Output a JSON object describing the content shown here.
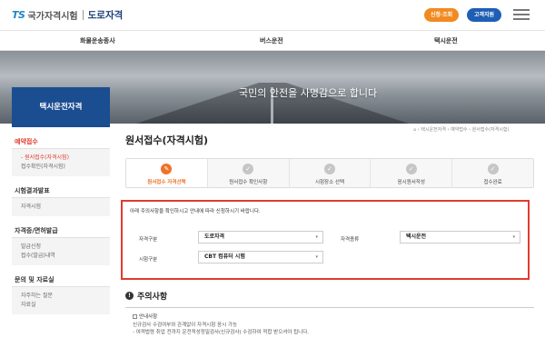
{
  "header": {
    "logo_mark": "TS",
    "logo_name": "국가자격시험",
    "logo_sub": "도로자격",
    "btn_apply_check": "신청·조회",
    "btn_support": "고객지원"
  },
  "gnb": [
    "화물운송종사",
    "버스운전",
    "택시운전"
  ],
  "banner": {
    "slogan": "국민의 안전을 사명감으로 합니다"
  },
  "sidebar": {
    "title": "택시운전자격",
    "groups": [
      {
        "label": "예약접수",
        "active": true,
        "items": [
          {
            "label": "- 원서접수(자격시험)",
            "on": true
          },
          {
            "label": "접수확인(자격시험)",
            "on": false
          }
        ]
      },
      {
        "label": "시험결과발표",
        "active": false,
        "items": [
          {
            "label": "자격시험",
            "on": false
          }
        ]
      },
      {
        "label": "자격증/면허발급",
        "active": false,
        "items": [
          {
            "label": "발급신청",
            "on": false
          },
          {
            "label": "접수(발급)내역",
            "on": false
          }
        ]
      },
      {
        "label": "문의 및 자료실",
        "active": false,
        "items": [
          {
            "label": "자주하는 질문",
            "on": false
          },
          {
            "label": "자료실",
            "on": false
          }
        ]
      }
    ]
  },
  "breadcrumb": "⌂ › 택시운전자격 › 예약접수 › 원서접수(자격시험)",
  "page": {
    "title": "원서접수(자격시험)"
  },
  "steps": [
    {
      "label": "원서접수 자격선택",
      "icon": "✎"
    },
    {
      "label": "원서접수 확인사항",
      "icon": "✓"
    },
    {
      "label": "시험장소 선택",
      "icon": "✓"
    },
    {
      "label": "응시원서작성",
      "icon": "✓"
    },
    {
      "label": "접수완료",
      "icon": "✓"
    }
  ],
  "form": {
    "notice": "아래 주의사항을 확인하시고 안내에 따라 신청하시기 바랍니다.",
    "field1_label": "자격구분",
    "field1_value": "도로자격",
    "field2_label": "자격종류",
    "field2_value": "택시운전",
    "field3_label": "시험구분",
    "field3_value": "CBT 컴퓨터 시험"
  },
  "caution": {
    "title": "주의사항",
    "check_label": "안내사항",
    "line1": "신규검사 수검여부와 관계없이 자격시험 응시 가능",
    "line2": "- 여객법령 취업 전까지 운전적성정밀검사(신규검사) 수검하여 적합 받으셔야 됩니다."
  },
  "colors": {
    "accent_orange": "#ef7326",
    "navy": "#1b4d91",
    "red_box": "#e23b2f"
  }
}
